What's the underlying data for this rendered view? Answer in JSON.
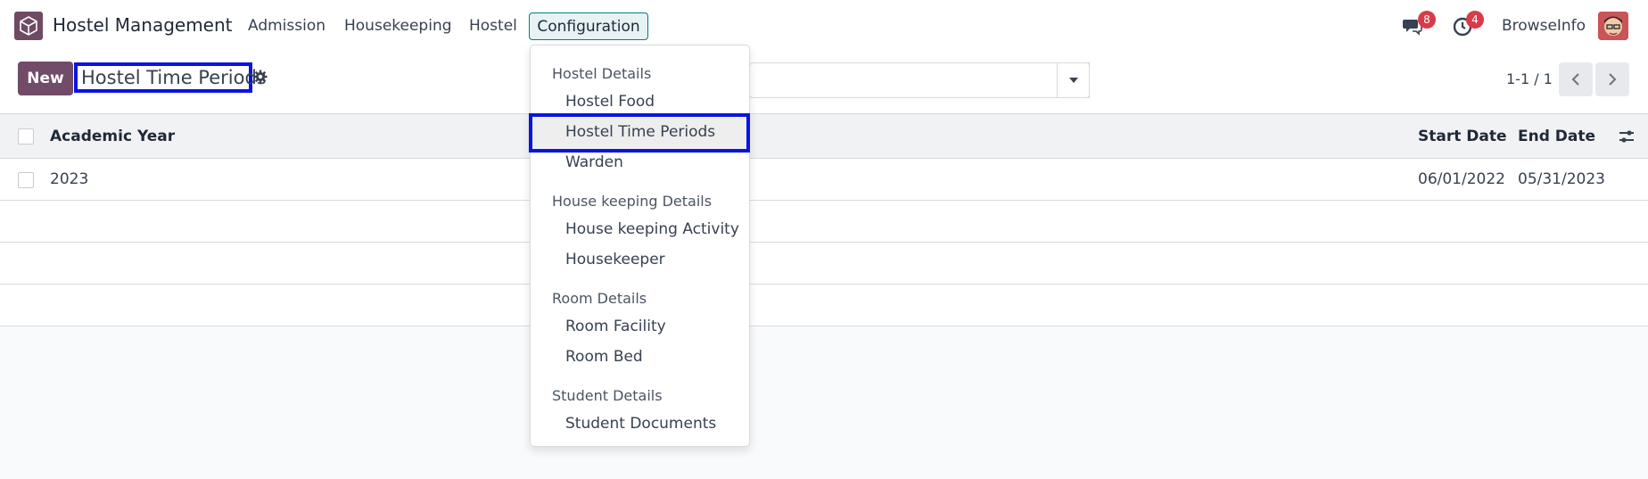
{
  "app": {
    "name": "Hostel Management",
    "icon": "cube-app-icon"
  },
  "nav": {
    "items": [
      "Admission",
      "Housekeeping",
      "Hostel"
    ],
    "active": "Configuration"
  },
  "systray": {
    "messages_badge": "8",
    "activities_badge": "4",
    "user_name": "BrowseInfo"
  },
  "control": {
    "new_label": "New",
    "title": "Hostel Time Periods",
    "pager": "1-1 / 1"
  },
  "table": {
    "columns": {
      "academic_year": "Academic Year",
      "start_date": "Start Date",
      "end_date": "End Date"
    },
    "rows": [
      {
        "academic_year": "2023",
        "start_date": "06/01/2022",
        "end_date": "05/31/2023"
      }
    ]
  },
  "dropdown": {
    "sections": [
      {
        "header": "Hostel Details",
        "items": [
          "Hostel Food",
          "Hostel Time Periods",
          "Warden"
        ]
      },
      {
        "header": "House keeping Details",
        "items": [
          "House keeping Activity",
          "Housekeeper"
        ]
      },
      {
        "header": "Room Details",
        "items": [
          "Room Facility",
          "Room Bed"
        ]
      },
      {
        "header": "Student Details",
        "items": [
          "Student Documents"
        ]
      }
    ],
    "selected": "Hostel Time Periods"
  },
  "colors": {
    "brand": "#714b67",
    "highlight_border": "#0a14e0",
    "badge": "#d83b49"
  }
}
